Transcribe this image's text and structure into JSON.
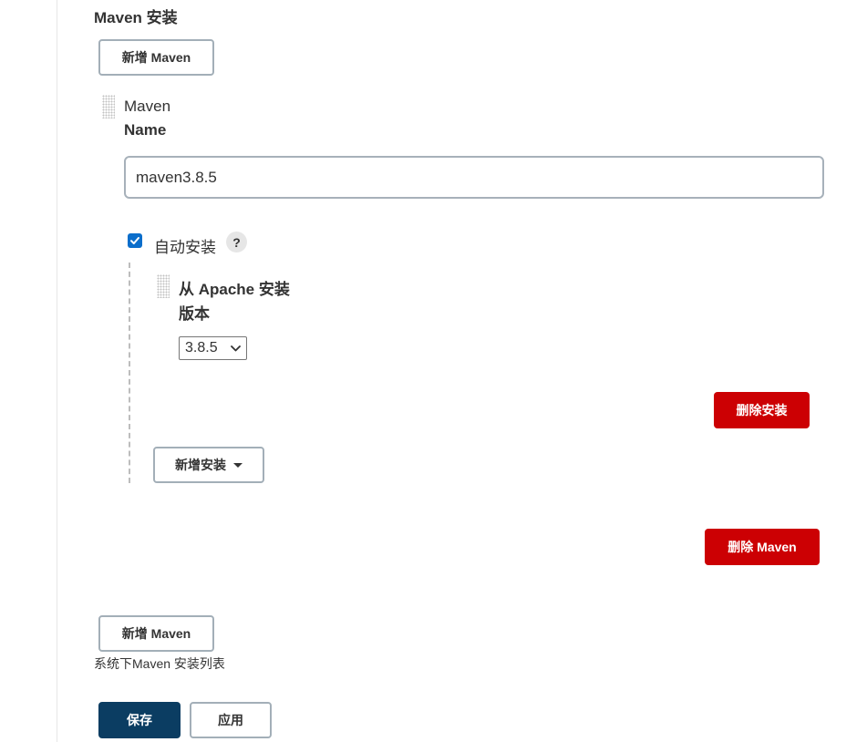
{
  "section": {
    "title": "Maven 安装",
    "add_top_label": "新增 Maven",
    "add_bottom_label": "新增 Maven",
    "description": "系统下Maven 安装列表"
  },
  "maven_item": {
    "header": "Maven",
    "name_label": "Name",
    "name_value": "maven3.8.5",
    "auto_install_label": "自动安装",
    "auto_install_checked": true,
    "help_glyph": "?",
    "delete_label": "删除 Maven"
  },
  "installer": {
    "title": "从 Apache 安装",
    "version_label": "版本",
    "version_value": "3.8.5",
    "delete_label": "删除安装",
    "add_label": "新增安装"
  },
  "footer": {
    "save_label": "保存",
    "apply_label": "应用"
  },
  "colors": {
    "primary": "#0b3d62",
    "danger": "#cc0003",
    "checkbox": "#0b6ecb",
    "border": "#a3afb8"
  },
  "icons": {
    "drag": "drag-handle-icon",
    "help": "question-icon",
    "dropdown": "caret-down-icon",
    "check": "checkmark-icon"
  }
}
